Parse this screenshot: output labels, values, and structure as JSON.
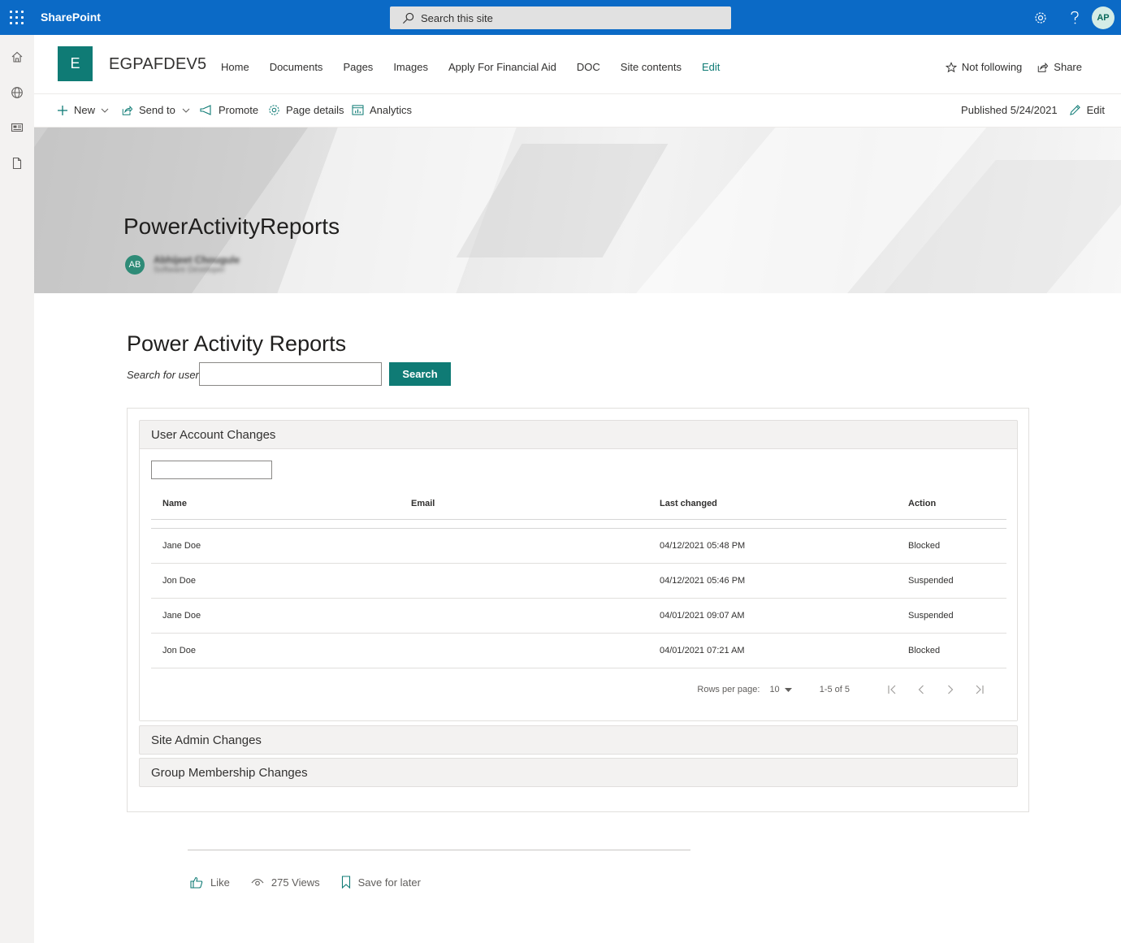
{
  "suite": {
    "brand": "SharePoint",
    "search_placeholder": "Search this site",
    "user_initials": "AP"
  },
  "rail": {
    "items": [
      "home-icon",
      "globe-icon",
      "news-icon",
      "page-icon"
    ]
  },
  "site": {
    "logo_letter": "E",
    "title": "EGPAFDEV5",
    "nav": [
      "Home",
      "Documents",
      "Pages",
      "Images",
      "Apply For Financial Aid",
      "DOC",
      "Site contents"
    ],
    "edit_label": "Edit",
    "follow_label": "Not following",
    "share_label": "Share"
  },
  "commands": {
    "new": "New",
    "send_to": "Send to",
    "promote": "Promote",
    "page_details": "Page details",
    "analytics": "Analytics",
    "published": "Published 5/24/2021",
    "edit": "Edit"
  },
  "hero": {
    "title": "PowerActivityReports",
    "author_initials": "AB",
    "author_name": "Abhijeet Chougule",
    "author_role": "Software Developer"
  },
  "content": {
    "heading": "Power Activity Reports",
    "search_label": "Search for user",
    "search_button": "Search"
  },
  "accordions": {
    "user_account": {
      "title": "User Account Changes",
      "columns": [
        "Name",
        "Email",
        "Last changed",
        "Action"
      ],
      "rows": [
        {
          "name": "Jane Doe",
          "email": "",
          "last_changed": "04/12/2021 05:48 PM",
          "action": "Blocked"
        },
        {
          "name": "Jon Doe",
          "email": "",
          "last_changed": "04/12/2021 05:46 PM",
          "action": "Suspended"
        },
        {
          "name": "Jane Doe",
          "email": "",
          "last_changed": "04/01/2021 09:07 AM",
          "action": "Suspended"
        },
        {
          "name": "Jon Doe",
          "email": "",
          "last_changed": "04/01/2021 07:21 AM",
          "action": "Blocked"
        }
      ],
      "pager": {
        "rows_per_page_label": "Rows per page:",
        "rows_per_page": "10",
        "range": "1-5 of 5"
      }
    },
    "site_admin": {
      "title": "Site Admin Changes"
    },
    "group_membership": {
      "title": "Group Membership Changes"
    }
  },
  "footer": {
    "like": "Like",
    "views": "275 Views",
    "save": "Save for later"
  },
  "colors": {
    "suite_blue": "#0b6ac6",
    "accent_teal": "#0f7b75"
  }
}
